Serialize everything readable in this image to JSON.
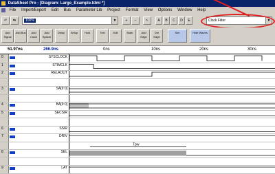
{
  "title": "DataSheet Pro - [Diagram: Large_Example.tdml *]",
  "menu": [
    "File",
    "Import/Export",
    "Edit",
    "Bus",
    "Parameter Lib",
    "Project",
    "Format",
    "View",
    "Options",
    "Window",
    "Help"
  ],
  "toolbar": {
    "zoom_value": "100%",
    "filter_value": "Clock Filter",
    "highlight": "red circle around filter combo"
  },
  "buttons2": [
    "Add Signal",
    "Add Bus",
    "Add Clock",
    "Add Spacer",
    "Delay",
    "Setup",
    "Hold",
    "Text",
    "Edit",
    "Mark",
    "Add Edge",
    "Del Edge",
    "Sim",
    "Hide Waves"
  ],
  "timeline": {
    "cursor_a": "51.97ns",
    "cursor_b": "266.9ns",
    "ticks": [
      "0ns",
      "10ns",
      "20ns",
      "30ns"
    ]
  },
  "signals": [
    {
      "num": "0",
      "name": "SYSCLOCK"
    },
    {
      "num": "1",
      "name": "STIMCLK"
    },
    {
      "num": "2",
      "name": "RELAOUT"
    },
    {
      "num": "",
      "name": ""
    },
    {
      "num": "3",
      "name": "SA[9:0]"
    },
    {
      "num": "",
      "name": ""
    },
    {
      "num": "4",
      "name": "BA[9:0]"
    },
    {
      "num": "5",
      "name": "SECSIR"
    },
    {
      "num": "",
      "name": ""
    },
    {
      "num": "6",
      "name": "SSIR"
    },
    {
      "num": "7",
      "name": "DRIV"
    },
    {
      "num": "",
      "name": ""
    },
    {
      "num": "8",
      "name": "SEL"
    },
    {
      "num": "",
      "name": ""
    },
    {
      "num": "9",
      "name": "LAT"
    }
  ],
  "annotation_tpw": "Tpw"
}
